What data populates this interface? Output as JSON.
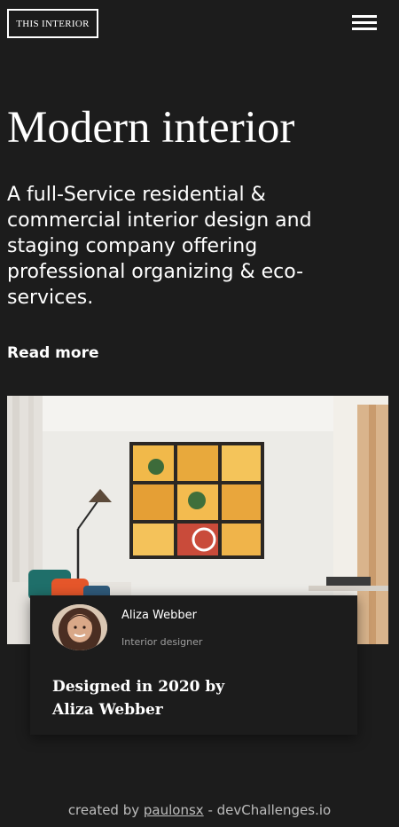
{
  "header": {
    "logo_text": "THIS INTERIOR",
    "menu_icon": "hamburger-menu-icon"
  },
  "hero": {
    "title": "Modern interior",
    "description": "A full-Service residential & commercial interior design and staging company offering professional organizing & eco-services.",
    "read_more_label": "Read more"
  },
  "card": {
    "author_name": "Aliza Webber",
    "author_role": "Interior designer",
    "caption": "Designed in 2020 by Aliza Webber"
  },
  "footer": {
    "prefix": "created by",
    "author_link": "paulonsx",
    "suffix": "- devChallenges.io"
  },
  "colors": {
    "background": "#1c1c1c",
    "text": "#ffffff",
    "muted": "#9e9e9e"
  }
}
